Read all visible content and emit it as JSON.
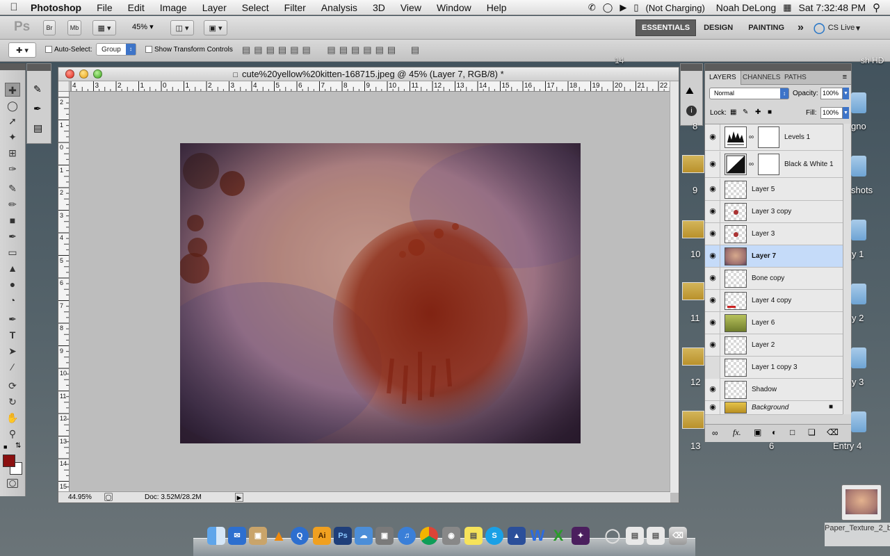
{
  "menubar": {
    "app_name": "Photoshop",
    "items": [
      "File",
      "Edit",
      "Image",
      "Layer",
      "Select",
      "Filter",
      "Analysis",
      "3D",
      "View",
      "Window",
      "Help"
    ],
    "battery_status": "(Not Charging)",
    "user": "Noah DeLong",
    "clock": "Sat 7:32:48 PM"
  },
  "appbar": {
    "ps_logo": "Ps",
    "bridge_label": "Br",
    "minibridge_label": "Mb",
    "zoom": "45%",
    "workspaces": [
      "ESSENTIALS",
      "DESIGN",
      "PAINTING"
    ],
    "more": "»",
    "cs_live": "CS Live"
  },
  "options": {
    "auto_select_label": "Auto-Select:",
    "auto_select_value": "Group",
    "transform_label": "Show Transform Controls"
  },
  "document": {
    "title": "cute%20yellow%20kitten-168715.jpeg @ 45% (Layer 7, RGB/8) *",
    "zoom_status": "44.95%",
    "doc_size": "Doc: 3.52M/28.2M",
    "ruler_h_labels": [
      "4",
      "3",
      "2",
      "1",
      "0",
      "1",
      "2",
      "3",
      "4",
      "5",
      "6",
      "7",
      "8",
      "9",
      "10",
      "11",
      "12",
      "13",
      "14",
      "15",
      "16",
      "17",
      "18",
      "19",
      "20",
      "21",
      "22",
      "23",
      "2"
    ],
    "ruler_v_labels": [
      "2",
      "1",
      "0",
      "1",
      "2",
      "3",
      "4",
      "5",
      "6",
      "7",
      "8",
      "9",
      "10",
      "11",
      "12",
      "13",
      "14",
      "15",
      "16"
    ]
  },
  "layers_panel": {
    "tabs": [
      "LAYERS",
      "CHANNELS",
      "PATHS"
    ],
    "blend_mode": "Normal",
    "opacity_label": "Opacity:",
    "opacity": "100%",
    "lock_label": "Lock:",
    "fill_label": "Fill:",
    "fill": "100%",
    "layers": [
      {
        "name": "Levels 1",
        "visible": true,
        "kind": "adjustment",
        "thumb": "levels-icon",
        "selected": false
      },
      {
        "name": "Black & White 1",
        "visible": true,
        "kind": "adjustment",
        "thumb": "black-white-icon",
        "selected": false
      },
      {
        "name": "Layer 5",
        "visible": true,
        "kind": "pixel",
        "selected": false
      },
      {
        "name": "Layer 3 copy",
        "visible": true,
        "kind": "pixel",
        "selected": false
      },
      {
        "name": "Layer 3",
        "visible": true,
        "kind": "pixel",
        "selected": false
      },
      {
        "name": "Layer 7",
        "visible": true,
        "kind": "pixel",
        "selected": true
      },
      {
        "name": "Bone copy",
        "visible": true,
        "kind": "pixel",
        "selected": false
      },
      {
        "name": "Layer 4 copy",
        "visible": true,
        "kind": "pixel",
        "selected": false
      },
      {
        "name": "Layer 6",
        "visible": true,
        "kind": "pixel",
        "selected": false
      },
      {
        "name": "Layer 2",
        "visible": true,
        "kind": "pixel",
        "selected": false
      },
      {
        "name": "Layer 1 copy 3",
        "visible": false,
        "kind": "pixel",
        "selected": false
      },
      {
        "name": "Shadow",
        "visible": true,
        "kind": "pixel",
        "selected": false
      },
      {
        "name": "Background",
        "visible": true,
        "kind": "pixel",
        "selected": false,
        "locked": true
      }
    ]
  },
  "desktop": {
    "left_numbers": [
      "8",
      "9",
      "10",
      "11",
      "12",
      "13"
    ],
    "right_labels": [
      "gno",
      "shots",
      "y 1",
      "y 2",
      "y 3",
      "Entry 4"
    ],
    "top_labels": [
      "14",
      "sh HD"
    ],
    "bottom_number": "6",
    "stack_label": "Paper_Texture_2_by...k.jpeg"
  },
  "colors": {
    "accent_selected": "#c5dbf9",
    "foreground_swatch": "#8b1010",
    "background_swatch": "#ffffff"
  }
}
